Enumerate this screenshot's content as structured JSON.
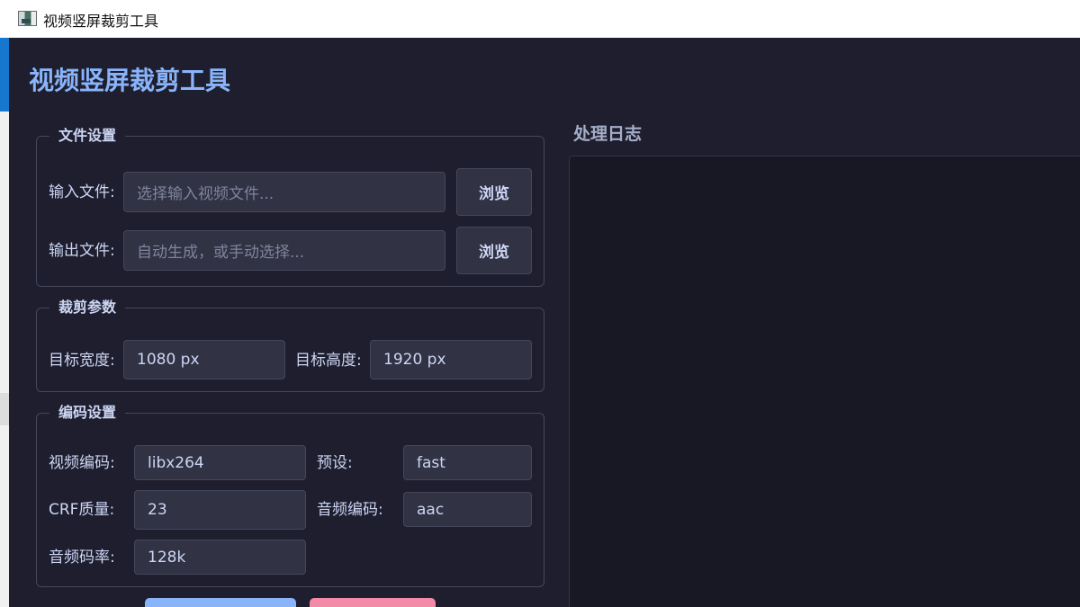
{
  "window": {
    "title": "视频竖屏裁剪工具"
  },
  "app": {
    "title": "视频竖屏裁剪工具"
  },
  "file_settings": {
    "title": "文件设置",
    "input_label": "输入文件:",
    "input_placeholder": "选择输入视频文件...",
    "input_browse": "浏览",
    "output_label": "输出文件:",
    "output_placeholder": "自动生成，或手动选择...",
    "output_browse": "浏览"
  },
  "crop_params": {
    "title": "裁剪参数",
    "width_label": "目标宽度:",
    "width_value": "1080 px",
    "height_label": "目标高度:",
    "height_value": "1920 px"
  },
  "encode_settings": {
    "title": "编码设置",
    "video_codec_label": "视频编码:",
    "video_codec_value": "libx264",
    "preset_label": "预设:",
    "preset_value": "fast",
    "crf_label": "CRF质量:",
    "crf_value": "23",
    "audio_codec_label": "音频编码:",
    "audio_codec_value": "aac",
    "audio_bitrate_label": "音频码率:",
    "audio_bitrate_value": "128k"
  },
  "log": {
    "title": "处理日志"
  },
  "colors": {
    "background": "#1e1e2e",
    "accent_blue": "#89b4fa",
    "accent_pink": "#f38ba8",
    "input_bg": "#313244",
    "border": "#45475a"
  }
}
